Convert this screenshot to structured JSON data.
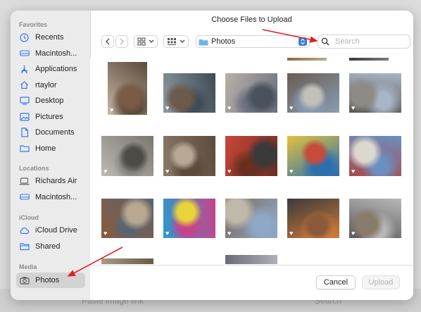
{
  "dialog": {
    "title": "Choose Files to Upload"
  },
  "sidebar": {
    "favorites_title": "Favorites",
    "favorites": [
      {
        "label": "Recents",
        "icon": "clock-icon"
      },
      {
        "label": "Macintosh...",
        "icon": "hard-drive-icon"
      },
      {
        "label": "Applications",
        "icon": "applications-icon"
      },
      {
        "label": "rtaylor",
        "icon": "home-user-icon"
      },
      {
        "label": "Desktop",
        "icon": "desktop-icon"
      },
      {
        "label": "Pictures",
        "icon": "pictures-icon"
      },
      {
        "label": "Documents",
        "icon": "document-icon"
      },
      {
        "label": "Home",
        "icon": "folder-icon"
      }
    ],
    "locations_title": "Locations",
    "locations": [
      {
        "label": "Richards Air",
        "icon": "laptop-icon"
      },
      {
        "label": "Macintosh...",
        "icon": "hard-drive-icon"
      }
    ],
    "icloud_title": "iCloud",
    "icloud": [
      {
        "label": "iCloud Drive",
        "icon": "cloud-icon"
      },
      {
        "label": "Shared",
        "icon": "shared-folder-icon"
      }
    ],
    "media_title": "Media",
    "media": [
      {
        "label": "Photos",
        "icon": "camera-icon",
        "selected": true
      }
    ]
  },
  "toolbar": {
    "location": "Photos",
    "search_placeholder": "Search"
  },
  "footer": {
    "cancel_label": "Cancel",
    "upload_label": "Upload"
  },
  "background": {
    "paste_text": "Paste image link",
    "search_text": "Search"
  },
  "photos": [
    {
      "palette": [
        "#5a4a3a",
        "#c9b9a6",
        "#7a5a48"
      ]
    },
    {
      "palette": [
        "#3f4a56",
        "#8c9aa0",
        "#6c5a4b"
      ]
    },
    {
      "palette": [
        "#6a7080",
        "#b8b0a8",
        "#49525c"
      ]
    },
    {
      "palette": [
        "#8a9cb3",
        "#6a5c50",
        "#c3c0b8"
      ]
    },
    {
      "palette": [
        "#a8b5c6",
        "#5c5650",
        "#8e8a86"
      ]
    },
    {
      "palette": [
        "#7a7670",
        "#bdbab4",
        "#4e4a46"
      ]
    },
    {
      "palette": [
        "#5c4a3a",
        "#8a7a68",
        "#b6a894"
      ]
    },
    {
      "palette": [
        "#6b2e1f",
        "#c8463a",
        "#3a3a3a"
      ]
    },
    {
      "palette": [
        "#2b6fb0",
        "#e2c33b",
        "#c84a3a"
      ]
    },
    {
      "palette": [
        "#6b8fc0",
        "#a84a4a",
        "#dcd8d0"
      ]
    },
    {
      "palette": [
        "#5a6470",
        "#8a5a3a",
        "#b8a890"
      ]
    },
    {
      "palette": [
        "#c8428a",
        "#2a9ad0",
        "#e8d43a"
      ]
    },
    {
      "palette": [
        "#8fa8c8",
        "#7a6a58",
        "#c0b8a8"
      ]
    },
    {
      "palette": [
        "#d07a3a",
        "#3a3a3a",
        "#8a5a3a"
      ]
    },
    {
      "palette": [
        "#b8b8b8",
        "#5a5a5a",
        "#8a7a6a"
      ]
    }
  ],
  "partial_photos": [
    {
      "palette": [
        "#8a6a4a",
        "#c0a888"
      ]
    },
    {
      "palette": [
        "#3a3a3a",
        "#7a7a7a"
      ]
    },
    {
      "palette": [
        "#a89888",
        "#6a5a4a"
      ]
    },
    {
      "palette": [
        "#6a6a7a",
        "#b0b0b8"
      ]
    }
  ]
}
